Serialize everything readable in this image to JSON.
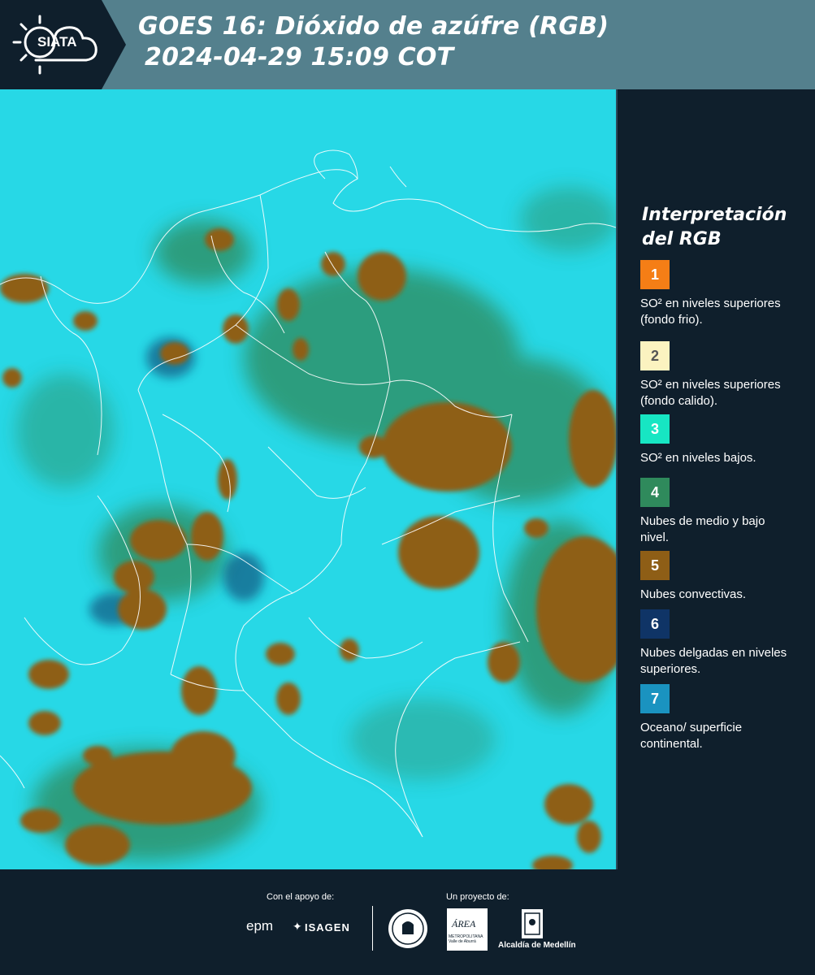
{
  "header": {
    "logo_text": "SIATA",
    "title_line1": "GOES 16: Dióxido de azúfre (RGB)",
    "title_line2": "2024-04-29 15:09 COT"
  },
  "legend": {
    "title": "Interpretación del RGB",
    "items": [
      {
        "number": "1",
        "label": "SO² en niveles superiores (fondo frio).",
        "color": "#f57e16"
      },
      {
        "number": "2",
        "label": "SO² en niveles superiores (fondo calido).",
        "color": "#fbf3c0"
      },
      {
        "number": "3",
        "label": "SO² en niveles bajos.",
        "color": "#17e6c3"
      },
      {
        "number": "4",
        "label": "Nubes de medio y bajo nivel.",
        "color": "#2f8a5c"
      },
      {
        "number": "5",
        "label": "Nubes convectivas.",
        "color": "#8e5e16"
      },
      {
        "number": "6",
        "label": "Nubes delgadas en niveles superiores.",
        "color": "#0f3466"
      },
      {
        "number": "7",
        "label": "Oceano/ superficie continental.",
        "color": "#1a93c0"
      }
    ]
  },
  "footer": {
    "support_label": "Con el apoyo de:",
    "project_label": "Un proyecto de:",
    "sponsor1": "epm",
    "sponsor2": "ISAGEN",
    "partner1_text": "ÁREA",
    "partner1_sub": "METROPOLITANA Valle de Aburrá",
    "partner2": "Alcaldía de Medellín"
  },
  "colors": {
    "map_base": "#27d8e6",
    "convective": "#8e5e16",
    "mid_low": "#2f8a5c",
    "header_bar": "#54808d",
    "panel": "#0f1f2c"
  }
}
